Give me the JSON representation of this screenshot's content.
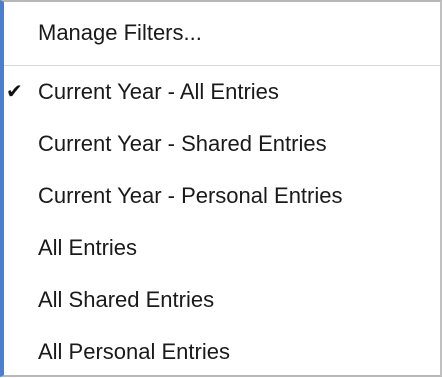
{
  "menu": {
    "header_label": "Manage Filters...",
    "items": [
      {
        "label": "Current Year - All Entries",
        "checked": true,
        "check_glyph": "✔"
      },
      {
        "label": "Current Year - Shared Entries",
        "checked": false
      },
      {
        "label": "Current Year - Personal Entries",
        "checked": false
      },
      {
        "label": "All Entries",
        "checked": false
      },
      {
        "label": "All Shared Entries",
        "checked": false
      },
      {
        "label": "All Personal Entries",
        "checked": false
      }
    ]
  },
  "colors": {
    "accent_border": "#4a7fd0",
    "text": "#1a1a1a",
    "background": "#ffffff"
  }
}
